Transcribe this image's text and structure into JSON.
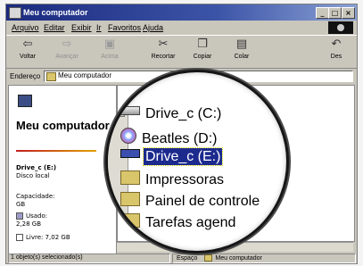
{
  "window": {
    "title": "Meu computador",
    "controls": {
      "minimize": "_",
      "maximize": "□",
      "close": "×"
    }
  },
  "menu": [
    {
      "label": "Arquivo"
    },
    {
      "label": "Editar"
    },
    {
      "label": "Exibir"
    },
    {
      "label": "Ir"
    },
    {
      "label": "Favoritos"
    },
    {
      "label": "Ajuda"
    }
  ],
  "toolbar": {
    "buttons": [
      {
        "label": "Voltar",
        "icon": "back-arrow-icon",
        "glyph": "⇦",
        "enabled": true
      },
      {
        "label": "Avançar",
        "icon": "forward-arrow-icon",
        "glyph": "⇨",
        "enabled": false
      },
      {
        "label": "Acima",
        "icon": "up-folder-icon",
        "glyph": "▣",
        "enabled": false
      },
      {
        "label": "Recortar",
        "icon": "scissors-icon",
        "glyph": "✂",
        "enabled": true
      },
      {
        "label": "Copiar",
        "icon": "copy-icon",
        "glyph": "❐",
        "enabled": true
      },
      {
        "label": "Colar",
        "icon": "paste-icon",
        "glyph": "▤",
        "enabled": true
      },
      {
        "label": "Des",
        "icon": "undo-icon",
        "glyph": "↶",
        "enabled": true
      }
    ]
  },
  "address": {
    "label": "Endereço",
    "value": "Meu computador"
  },
  "left_panel": {
    "title": "Meu computador",
    "drive_name": "Drive_c (E:)",
    "drive_type": "Disco local",
    "capacity": "Capacidade: GB",
    "used": "Usado: 2,28 GB",
    "free": "Livre: 7,02 GB"
  },
  "items": [
    {
      "label": "Drive_c (C:)",
      "icon": "hard-drive-icon",
      "selected": false
    },
    {
      "label": "Beatles (D:)",
      "icon": "cd-drive-icon",
      "selected": false
    },
    {
      "label": "Drive_c (E:)",
      "icon": "hard-drive-icon",
      "selected": true
    },
    {
      "label": "Impressoras",
      "icon": "printers-folder-icon",
      "selected": false
    },
    {
      "label": "Painel de controle",
      "icon": "control-panel-icon",
      "selected": false
    },
    {
      "label": "Tarefas agend",
      "icon": "scheduled-tasks-icon",
      "selected": false
    }
  ],
  "status": {
    "selection": "1 objeto(s) selecionado(s)",
    "space_label": "Espaço",
    "location": "Meu computador"
  },
  "colors": {
    "titlebar_start": "#1b2a7e",
    "selection": "#1c2a8e",
    "window_face": "#c9c6bc"
  }
}
